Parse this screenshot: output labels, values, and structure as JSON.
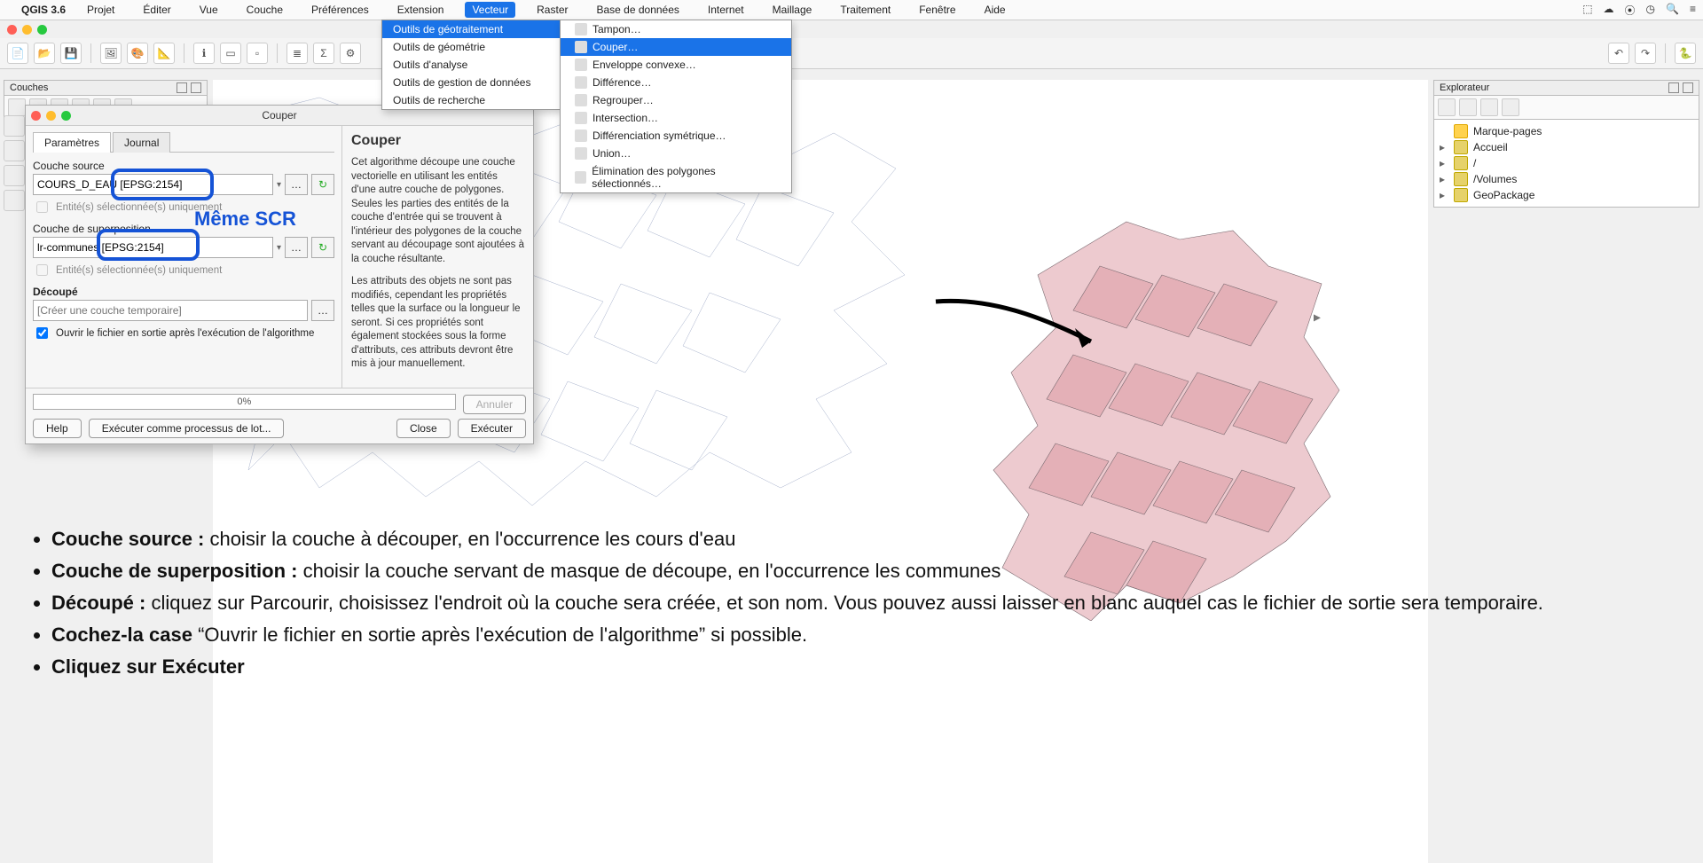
{
  "mac_menu": {
    "app": "QGIS 3.6",
    "items": [
      "Projet",
      "Éditer",
      "Vue",
      "Couche",
      "Préférences",
      "Extension",
      "Vecteur",
      "Raster",
      "Base de données",
      "Internet",
      "Maillage",
      "Traitement",
      "Fenêtre",
      "Aide"
    ],
    "active_index": 6
  },
  "vecteur_menu": {
    "items": [
      {
        "label": "Outils de géotraitement",
        "has_sub": true,
        "active": true
      },
      {
        "label": "Outils de géométrie",
        "has_sub": true
      },
      {
        "label": "Outils d'analyse",
        "has_sub": true
      },
      {
        "label": "Outils de gestion de données",
        "has_sub": true
      },
      {
        "label": "Outils de recherche",
        "has_sub": true
      }
    ]
  },
  "geotraitement_submenu": {
    "items": [
      {
        "label": "Tampon…"
      },
      {
        "label": "Couper…",
        "active": true
      },
      {
        "label": "Enveloppe convexe…"
      },
      {
        "label": "Différence…"
      },
      {
        "label": "Regrouper…"
      },
      {
        "label": "Intersection…"
      },
      {
        "label": "Différenciation symétrique…"
      },
      {
        "label": "Union…"
      },
      {
        "label": "Élimination des polygones sélectionnés…"
      }
    ]
  },
  "layers_panel": {
    "title": "Couches"
  },
  "explorer_panel": {
    "title": "Explorateur",
    "rows": [
      {
        "caret": "",
        "label": "Marque-pages",
        "star": true
      },
      {
        "caret": "▸",
        "label": "Accueil"
      },
      {
        "caret": "▸",
        "label": "/"
      },
      {
        "caret": "▸",
        "label": "/Volumes"
      },
      {
        "caret": "▸",
        "label": "GeoPackage"
      }
    ]
  },
  "dialog": {
    "title": "Couper",
    "tabs": {
      "parametres": "Paramètres",
      "journal": "Journal"
    },
    "labels": {
      "couche_source": "Couche source",
      "couche_superposition": "Couche de superposition",
      "decoupe": "Découpé",
      "entites_only": "Entité(s) sélectionnée(s) uniquement",
      "ouvrir_apres": "Ouvrir le fichier en sortie après l'exécution de l'algorithme"
    },
    "values": {
      "source": "COURS_D_EAU [EPSG:2154]",
      "overlay": "lr-communes [EPSG:2154]",
      "output_placeholder": "[Créer une couche temporaire]"
    },
    "annotation": "Même SCR",
    "help_title": "Couper",
    "help_p1": "Cet algorithme découpe une couche vectorielle en utilisant les entités d'une autre couche de polygones. Seules les parties des entités de la couche d'entrée qui se trouvent à l'intérieur des polygones de la couche servant au découpage sont ajoutées à la couche résultante.",
    "help_p2": "Les attributs des objets ne sont pas modifiés, cependant les propriétés telles que la surface ou la longueur le seront. Si ces propriétés sont également stockées sous la forme d'attributs, ces attributs devront être mis à jour manuellement.",
    "progress": "0%",
    "buttons": {
      "annuler": "Annuler",
      "help": "Help",
      "batch": "Exécuter comme processus de lot...",
      "close": "Close",
      "run": "Exécuter"
    }
  },
  "instructions": {
    "l1_b": "Couche source : ",
    "l1": "choisir la couche à découper, en l'occurrence les cours d'eau",
    "l2_b": "Couche de superposition : ",
    "l2": "choisir la couche servant de masque de découpe, en l'occurrence les communes",
    "l3_b": "Découpé : ",
    "l3": "cliquez sur Parcourir, choisissez l'endroit où la couche sera créée, et son nom. Vous pouvez aussi laisser en blanc auquel cas le fichier de sortie sera temporaire.",
    "l4_b": "Cochez-la case ",
    "l4": "“Ouvrir le fichier en sortie après l'exécution de l'algorithme” si possible.",
    "l5_b": "Cliquez sur Exécuter",
    "l5": ""
  }
}
